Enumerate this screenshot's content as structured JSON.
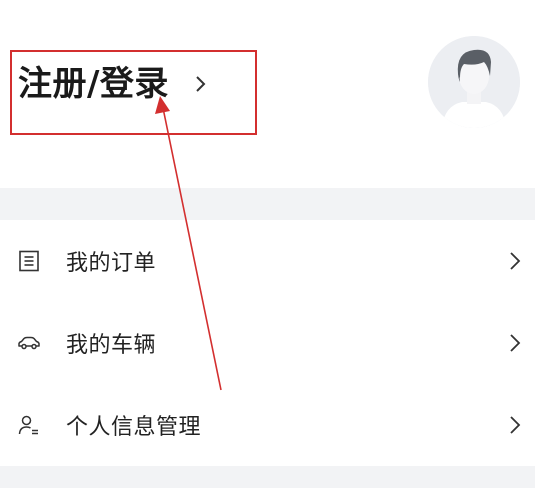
{
  "header": {
    "login_label": "注册/登录"
  },
  "menu": {
    "items": [
      {
        "label": "我的订单",
        "icon": "order-list-icon"
      },
      {
        "label": "我的车辆",
        "icon": "car-icon"
      },
      {
        "label": "个人信息管理",
        "icon": "user-profile-icon"
      }
    ]
  },
  "colors": {
    "annotation_red": "#d32f2f",
    "band_gray": "#f2f3f5",
    "avatar_bg": "#eceef2"
  }
}
